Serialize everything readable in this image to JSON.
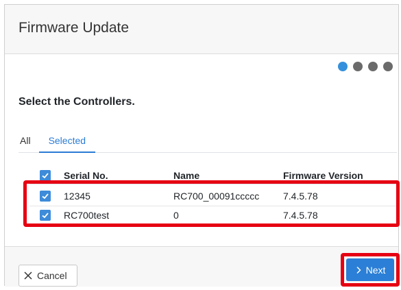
{
  "dialog": {
    "title": "Firmware Update",
    "steps": {
      "total": 4,
      "current": 1
    }
  },
  "section": {
    "title": "Select the Controllers."
  },
  "tabs": [
    {
      "label": "All",
      "active": false
    },
    {
      "label": "Selected",
      "active": true
    }
  ],
  "table": {
    "columns": [
      "Serial No.",
      "Name",
      "Firmware Version"
    ],
    "rows": [
      {
        "checked": true,
        "serial": "12345",
        "name": "RC700_00091ccccc",
        "firmware": "7.4.5.78"
      },
      {
        "checked": true,
        "serial": "RC700test",
        "name": "0",
        "firmware": "7.4.5.78"
      }
    ]
  },
  "footer": {
    "cancel_label": "Cancel",
    "next_label": "Next"
  },
  "colors": {
    "accent": "#2b7fd6",
    "highlight": "#e60012"
  },
  "icons": {
    "cancel": "close-icon",
    "next": "chevron-right-icon",
    "checkbox": "checkmark-icon"
  }
}
